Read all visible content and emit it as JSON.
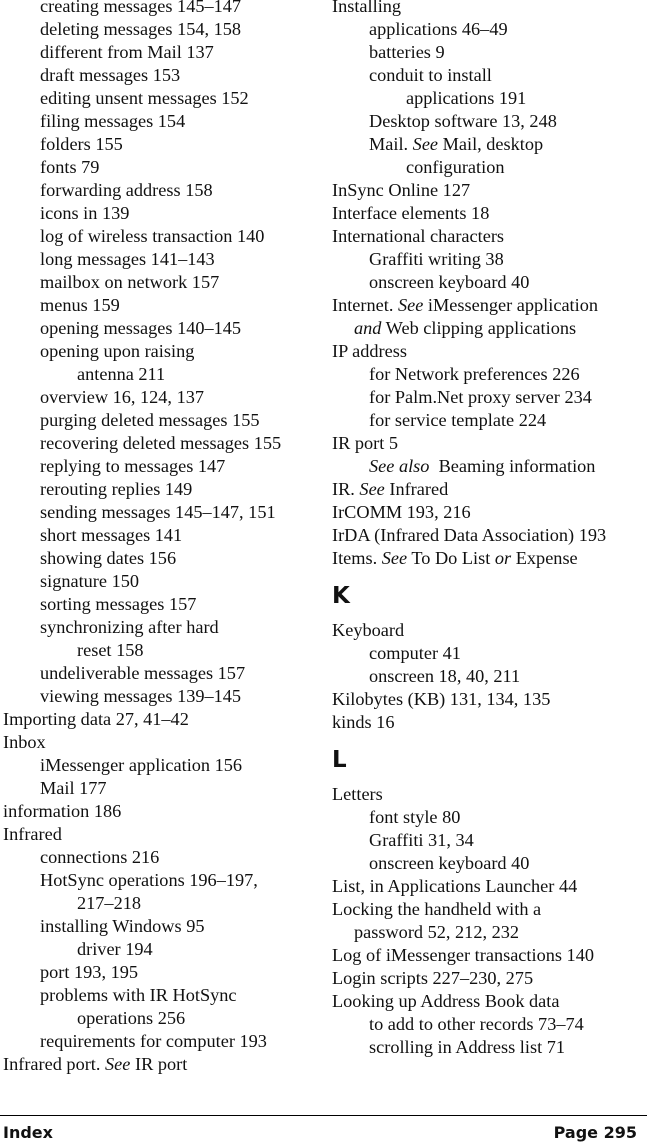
{
  "left_column": [
    {
      "level": 1,
      "parts": [
        {
          "t": "creating messages 145–147"
        }
      ]
    },
    {
      "level": 1,
      "parts": [
        {
          "t": "deleting messages 154, 158"
        }
      ]
    },
    {
      "level": 1,
      "parts": [
        {
          "t": "different from Mail 137"
        }
      ]
    },
    {
      "level": 1,
      "parts": [
        {
          "t": "draft messages 153"
        }
      ]
    },
    {
      "level": 1,
      "parts": [
        {
          "t": "editing unsent messages 152"
        }
      ]
    },
    {
      "level": 1,
      "parts": [
        {
          "t": "filing messages 154"
        }
      ]
    },
    {
      "level": 1,
      "parts": [
        {
          "t": "folders 155"
        }
      ]
    },
    {
      "level": 1,
      "parts": [
        {
          "t": "fonts 79"
        }
      ]
    },
    {
      "level": 1,
      "parts": [
        {
          "t": "forwarding address 158"
        }
      ]
    },
    {
      "level": 1,
      "parts": [
        {
          "t": "icons in 139"
        }
      ]
    },
    {
      "level": 1,
      "parts": [
        {
          "t": "log of wireless transaction 140"
        }
      ]
    },
    {
      "level": 1,
      "parts": [
        {
          "t": "long messages 141–143"
        }
      ]
    },
    {
      "level": 1,
      "parts": [
        {
          "t": "mailbox on network 157"
        }
      ]
    },
    {
      "level": 1,
      "parts": [
        {
          "t": "menus 159"
        }
      ]
    },
    {
      "level": 1,
      "parts": [
        {
          "t": "opening messages 140–145"
        }
      ]
    },
    {
      "level": 1,
      "parts": [
        {
          "t": "opening upon raising"
        }
      ]
    },
    {
      "level": 2,
      "parts": [
        {
          "t": "antenna 211"
        }
      ]
    },
    {
      "level": 1,
      "parts": [
        {
          "t": "overview 16, 124, 137"
        }
      ]
    },
    {
      "level": 1,
      "parts": [
        {
          "t": "purging deleted messages 155"
        }
      ]
    },
    {
      "level": 1,
      "parts": [
        {
          "t": "recovering deleted messages 155"
        }
      ]
    },
    {
      "level": 1,
      "parts": [
        {
          "t": "replying to messages 147"
        }
      ]
    },
    {
      "level": 1,
      "parts": [
        {
          "t": "rerouting replies 149"
        }
      ]
    },
    {
      "level": 1,
      "parts": [
        {
          "t": "sending messages 145–147, 151"
        }
      ]
    },
    {
      "level": 1,
      "parts": [
        {
          "t": "short messages 141"
        }
      ]
    },
    {
      "level": 1,
      "parts": [
        {
          "t": "showing dates 156"
        }
      ]
    },
    {
      "level": 1,
      "parts": [
        {
          "t": "signature 150"
        }
      ]
    },
    {
      "level": 1,
      "parts": [
        {
          "t": "sorting messages 157"
        }
      ]
    },
    {
      "level": 1,
      "parts": [
        {
          "t": "synchronizing after hard"
        }
      ]
    },
    {
      "level": 2,
      "parts": [
        {
          "t": "reset 158"
        }
      ]
    },
    {
      "level": 1,
      "parts": [
        {
          "t": "undeliverable messages 157"
        }
      ]
    },
    {
      "level": 1,
      "parts": [
        {
          "t": "viewing messages 139–145"
        }
      ]
    },
    {
      "level": 0,
      "parts": [
        {
          "t": "Importing data 27, 41–42"
        }
      ]
    },
    {
      "level": 0,
      "parts": [
        {
          "t": "Inbox"
        }
      ]
    },
    {
      "level": 1,
      "parts": [
        {
          "t": "iMessenger application 156"
        }
      ]
    },
    {
      "level": 1,
      "parts": [
        {
          "t": "Mail 177"
        }
      ]
    },
    {
      "level": 0,
      "parts": [
        {
          "t": "information 186"
        }
      ]
    },
    {
      "level": 0,
      "parts": [
        {
          "t": "Infrared"
        }
      ]
    },
    {
      "level": 1,
      "parts": [
        {
          "t": "connections 216"
        }
      ]
    },
    {
      "level": 1,
      "parts": [
        {
          "t": "HotSync operations 196–197,"
        }
      ]
    },
    {
      "level": 2,
      "parts": [
        {
          "t": "217–218"
        }
      ]
    },
    {
      "level": 1,
      "parts": [
        {
          "t": "installing Windows 95"
        }
      ]
    },
    {
      "level": 2,
      "parts": [
        {
          "t": "driver 194"
        }
      ]
    },
    {
      "level": 1,
      "parts": [
        {
          "t": "port 193, 195"
        }
      ]
    },
    {
      "level": 1,
      "parts": [
        {
          "t": "problems with IR HotSync"
        }
      ]
    },
    {
      "level": 2,
      "parts": [
        {
          "t": "operations 256"
        }
      ]
    },
    {
      "level": 1,
      "parts": [
        {
          "t": "requirements for computer 193"
        }
      ]
    },
    {
      "level": 0,
      "parts": [
        {
          "t": "Infrared port. "
        },
        {
          "t": "See",
          "i": true
        },
        {
          "t": " IR port"
        }
      ]
    }
  ],
  "right_column": [
    {
      "level": 0,
      "parts": [
        {
          "t": "Installing"
        }
      ]
    },
    {
      "level": 1,
      "parts": [
        {
          "t": "applications 46–49"
        }
      ]
    },
    {
      "level": 1,
      "parts": [
        {
          "t": "batteries 9"
        }
      ]
    },
    {
      "level": 1,
      "parts": [
        {
          "t": "conduit to install"
        }
      ]
    },
    {
      "level": 2,
      "parts": [
        {
          "t": "applications 191"
        }
      ]
    },
    {
      "level": 1,
      "parts": [
        {
          "t": "Desktop software 13, 248"
        }
      ]
    },
    {
      "level": 1,
      "parts": [
        {
          "t": "Mail. "
        },
        {
          "t": "See",
          "i": true
        },
        {
          "t": " Mail, desktop"
        }
      ]
    },
    {
      "level": 2,
      "parts": [
        {
          "t": "configuration"
        }
      ]
    },
    {
      "level": 0,
      "parts": [
        {
          "t": "InSync Online 127"
        }
      ]
    },
    {
      "level": 0,
      "parts": [
        {
          "t": "Interface elements 18"
        }
      ]
    },
    {
      "level": 0,
      "parts": [
        {
          "t": "International characters"
        }
      ]
    },
    {
      "level": 1,
      "parts": [
        {
          "t": "Graffiti writing 38"
        }
      ]
    },
    {
      "level": 1,
      "parts": [
        {
          "t": "onscreen keyboard 40"
        }
      ]
    },
    {
      "level": 0,
      "parts": [
        {
          "t": "Internet. "
        },
        {
          "t": "See",
          "i": true
        },
        {
          "t": " iMessenger application"
        }
      ]
    },
    {
      "level": "h",
      "parts": [
        {
          "t": "and",
          "i": true
        },
        {
          "t": " Web clipping applications"
        }
      ]
    },
    {
      "level": 0,
      "parts": [
        {
          "t": "IP address"
        }
      ]
    },
    {
      "level": 1,
      "parts": [
        {
          "t": "for Network preferences 226"
        }
      ]
    },
    {
      "level": 1,
      "parts": [
        {
          "t": "for Palm.Net proxy server 234"
        }
      ]
    },
    {
      "level": 1,
      "parts": [
        {
          "t": "for service template 224"
        }
      ]
    },
    {
      "level": 0,
      "parts": [
        {
          "t": "IR port 5"
        }
      ]
    },
    {
      "level": 1,
      "parts": [
        {
          "t": "See also",
          "i": true
        },
        {
          "t": "  Beaming information"
        }
      ]
    },
    {
      "level": 0,
      "parts": [
        {
          "t": "IR. "
        },
        {
          "t": "See",
          "i": true
        },
        {
          "t": " Infrared"
        }
      ]
    },
    {
      "level": 0,
      "parts": [
        {
          "t": "IrCOMM 193, 216"
        }
      ]
    },
    {
      "level": 0,
      "parts": [
        {
          "t": "IrDA (Infrared Data Association) 193"
        }
      ]
    },
    {
      "level": 0,
      "parts": [
        {
          "t": "Items. "
        },
        {
          "t": "See",
          "i": true
        },
        {
          "t": " To Do List "
        },
        {
          "t": "or",
          "i": true
        },
        {
          "t": " Expense"
        }
      ]
    },
    {
      "letter": "K"
    },
    {
      "level": 0,
      "parts": [
        {
          "t": "Keyboard"
        }
      ]
    },
    {
      "level": 1,
      "parts": [
        {
          "t": "computer 41"
        }
      ]
    },
    {
      "level": 1,
      "parts": [
        {
          "t": "onscreen 18, 40, 211"
        }
      ]
    },
    {
      "level": 0,
      "parts": [
        {
          "t": "Kilobytes (KB) 131, 134, 135"
        }
      ]
    },
    {
      "level": 0,
      "parts": [
        {
          "t": "kinds 16"
        }
      ]
    },
    {
      "letter": "L"
    },
    {
      "level": 0,
      "parts": [
        {
          "t": "Letters"
        }
      ]
    },
    {
      "level": 1,
      "parts": [
        {
          "t": "font style 80"
        }
      ]
    },
    {
      "level": 1,
      "parts": [
        {
          "t": "Graffiti 31, 34"
        }
      ]
    },
    {
      "level": 1,
      "parts": [
        {
          "t": "onscreen keyboard 40"
        }
      ]
    },
    {
      "level": 0,
      "parts": [
        {
          "t": "List, in Applications Launcher 44"
        }
      ]
    },
    {
      "level": 0,
      "parts": [
        {
          "t": "Locking the handheld with a"
        }
      ]
    },
    {
      "level": "h",
      "parts": [
        {
          "t": "password 52, 212, 232"
        }
      ]
    },
    {
      "level": 0,
      "parts": [
        {
          "t": "Log of iMessenger transactions 140"
        }
      ]
    },
    {
      "level": 0,
      "parts": [
        {
          "t": "Login scripts 227–230, 275"
        }
      ]
    },
    {
      "level": 0,
      "parts": [
        {
          "t": "Looking up Address Book data"
        }
      ]
    },
    {
      "level": 1,
      "parts": [
        {
          "t": "to add to other records 73–74"
        }
      ]
    },
    {
      "level": 1,
      "parts": [
        {
          "t": "scrolling in Address list 71"
        }
      ]
    }
  ],
  "footer": {
    "section": "Index",
    "page": "Page 295"
  }
}
